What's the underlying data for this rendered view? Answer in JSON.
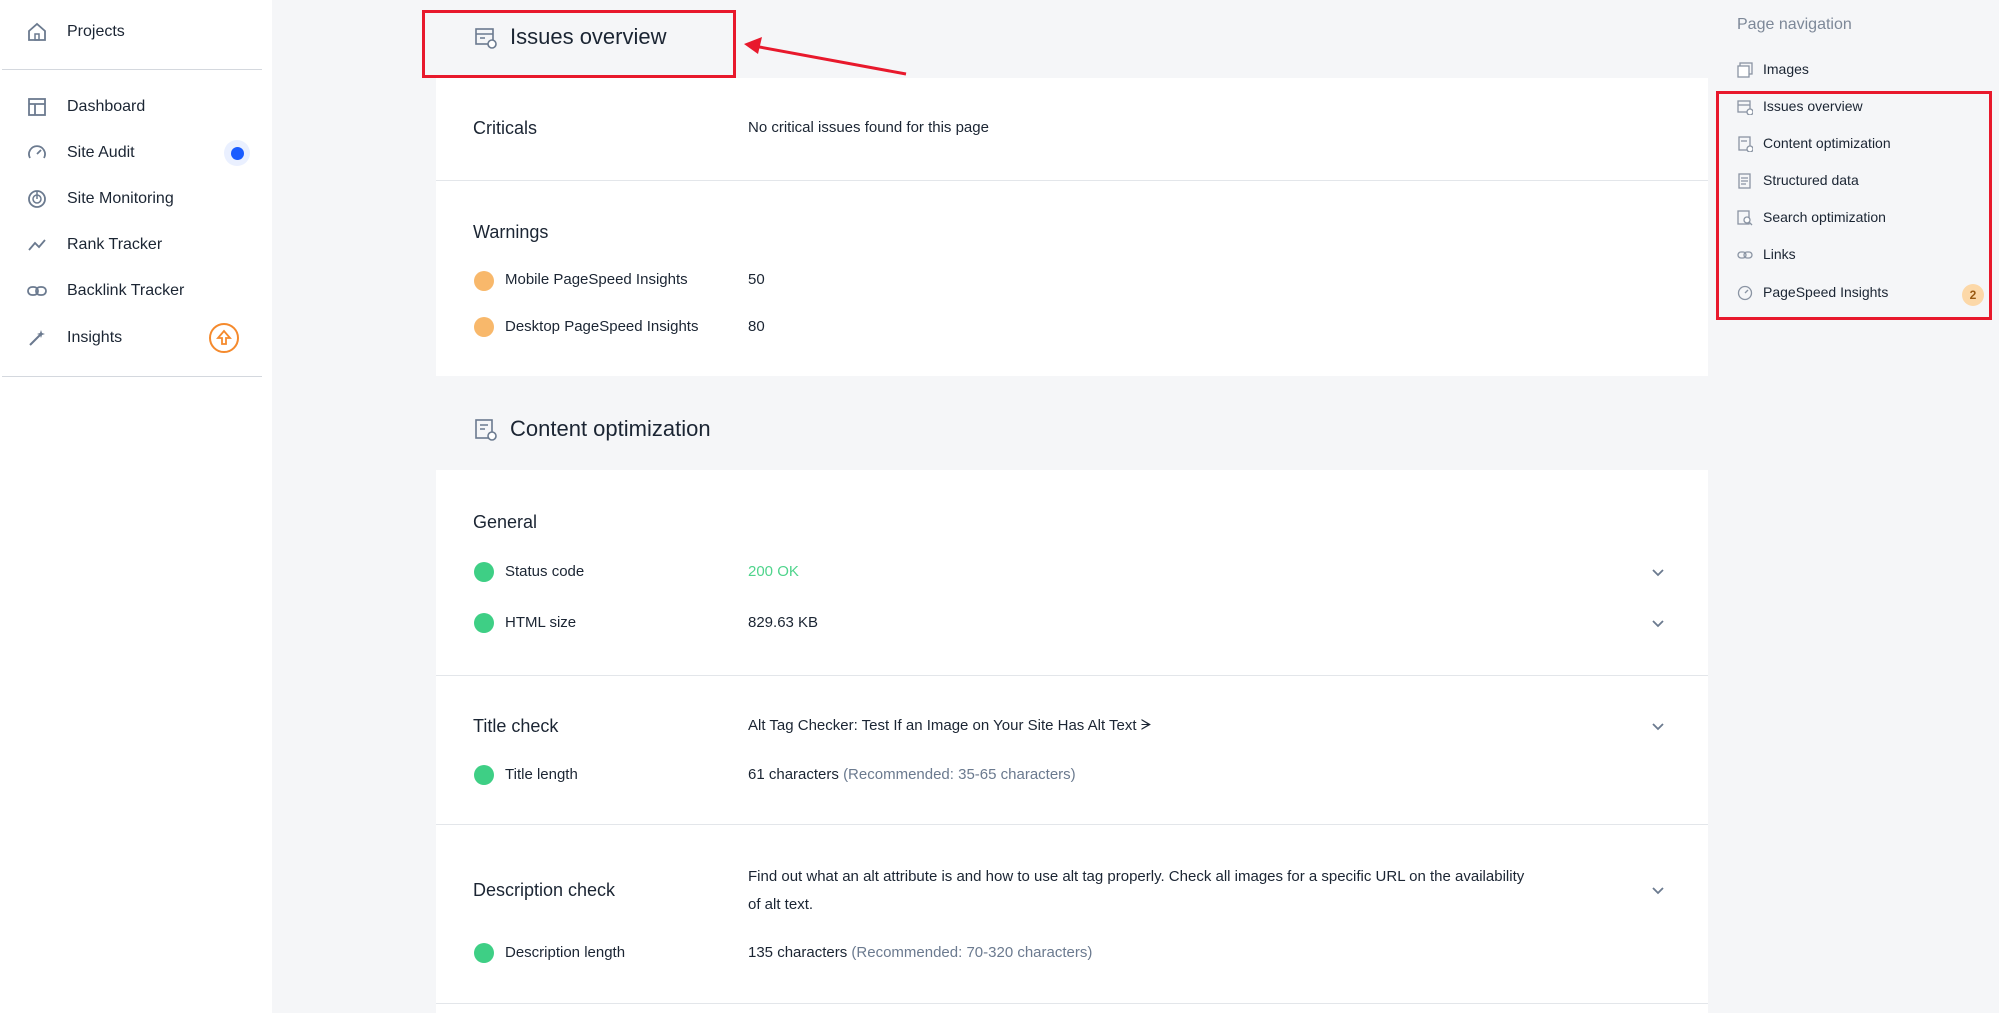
{
  "sidebar": {
    "items": [
      {
        "label": "Projects",
        "icon": "home-icon"
      },
      {
        "label": "Dashboard",
        "icon": "dashboard-icon"
      },
      {
        "label": "Site Audit",
        "icon": "speedometer-icon"
      },
      {
        "label": "Site Monitoring",
        "icon": "radar-icon"
      },
      {
        "label": "Rank Tracker",
        "icon": "trend-icon"
      },
      {
        "label": "Backlink Tracker",
        "icon": "link-icon"
      },
      {
        "label": "Insights",
        "icon": "magic-wand-icon"
      }
    ]
  },
  "issues": {
    "title": "Issues overview",
    "criticals_label": "Criticals",
    "criticals_value": "No critical issues found for this page",
    "warnings_label": "Warnings",
    "warnings": [
      {
        "label": "Mobile PageSpeed Insights",
        "value": "50"
      },
      {
        "label": "Desktop PageSpeed Insights",
        "value": "80"
      }
    ]
  },
  "content": {
    "title": "Content optimization",
    "general_label": "General",
    "general": [
      {
        "label": "Status code",
        "value": "200 OK"
      },
      {
        "label": "HTML size",
        "value": "829.63 KB"
      }
    ],
    "title_check": {
      "label": "Title check",
      "value": "Alt Tag Checker: Test If an Image on Your Site Has Alt Text ᗒ",
      "length_label": "Title length",
      "length_value": "61 characters",
      "length_hint": "(Recommended: 35-65 characters)"
    },
    "description_check": {
      "label": "Description check",
      "value_line1": "Find out what an alt attribute is and how to use alt tag properly. Check all images for a specific URL on the availability",
      "value_line2": "of alt text.",
      "length_label": "Description length",
      "length_value": "135 characters",
      "length_hint": "(Recommended: 70-320 characters)"
    }
  },
  "page_nav": {
    "title": "Page navigation",
    "items": [
      {
        "label": "Images",
        "icon": "images-icon"
      },
      {
        "label": "Issues overview",
        "icon": "issues-icon"
      },
      {
        "label": "Content optimization",
        "icon": "content-icon"
      },
      {
        "label": "Structured data",
        "icon": "structured-data-icon"
      },
      {
        "label": "Search optimization",
        "icon": "search-optimization-icon"
      },
      {
        "label": "Links",
        "icon": "link-icon"
      },
      {
        "label": "PageSpeed Insights",
        "icon": "gauge-icon",
        "badge": "2"
      }
    ]
  },
  "colors": {
    "accent": "#1a5cff",
    "ok": "#3ecf85",
    "warning": "#f8b86b",
    "highlight": "#e8192c"
  }
}
